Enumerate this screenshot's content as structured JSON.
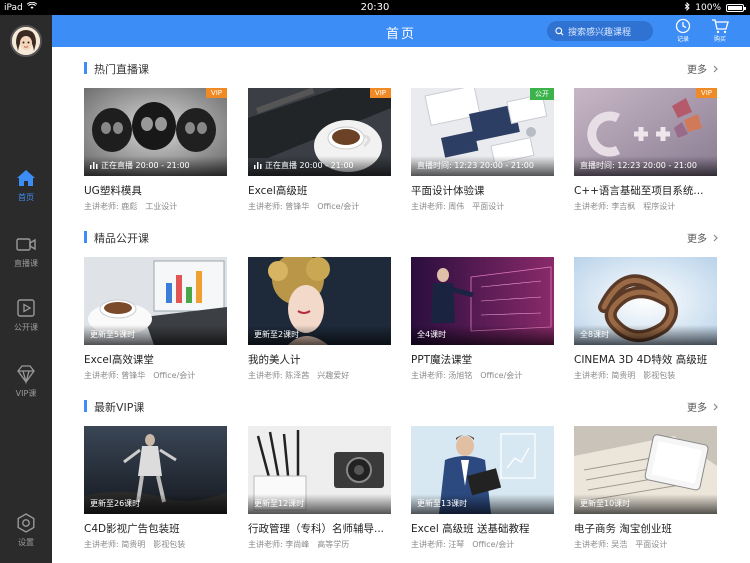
{
  "statusbar": {
    "device": "iPad",
    "time": "20:30",
    "battery": "100%",
    "battery_level": 1.0
  },
  "header": {
    "title": "首页",
    "search_placeholder": "搜索感兴趣课程",
    "record_label": "记录",
    "cart_label": "购买"
  },
  "sidebar": {
    "items": [
      {
        "label": "首页",
        "icon": "home-icon",
        "active": true
      },
      {
        "label": "直播课",
        "icon": "video-camera-icon"
      },
      {
        "label": "公开课",
        "icon": "play-box-icon"
      },
      {
        "label": "VIP课",
        "icon": "diamond-icon"
      },
      {
        "label": "设置",
        "icon": "gear-icon"
      }
    ]
  },
  "more_label": "更多",
  "sections": [
    {
      "title": "热门直播课",
      "cards": [
        {
          "title": "UG塑料模具",
          "teacher": "主讲老师: 鹿彪",
          "category": "工业设计",
          "caption": "正在直播    20:00 - 21:00",
          "badge": "VIP",
          "badge_type": "vip"
        },
        {
          "title": "Excel高级班",
          "teacher": "主讲老师: 曾锋华",
          "category": "Office/会计",
          "caption": "正在直播    20:00 - 21:00",
          "badge": "VIP",
          "badge_type": "vip"
        },
        {
          "title": "平面设计体验课",
          "teacher": "主讲老师: 周伟",
          "category": "平面设计",
          "caption": "直播时间: 12:23  20:00 - 21:00",
          "badge": "公开",
          "badge_type": "open"
        },
        {
          "title": "C++语言基础至项目系统...",
          "teacher": "主讲老师: 李吉枫",
          "category": "程序设计",
          "caption": "直播时间: 12:23  20:00 - 21:00",
          "badge": "VIP",
          "badge_type": "vip"
        }
      ]
    },
    {
      "title": "精品公开课",
      "cards": [
        {
          "title": "Excel高效课堂",
          "teacher": "主讲老师: 曾锋华",
          "category": "Office/会计",
          "caption": "更新至5课时"
        },
        {
          "title": "我的美人计",
          "teacher": "主讲老师: 陈泽茜",
          "category": "兴趣爱好",
          "caption": "更新至2课时"
        },
        {
          "title": "PPT魔法课堂",
          "teacher": "主讲老师: 汤旭铭",
          "category": "Office/会计",
          "caption": "全4课时"
        },
        {
          "title": "CINEMA 3D 4D特效 高级班",
          "teacher": "主讲老师: 简贵明",
          "category": "影视包装",
          "caption": "全8课时"
        }
      ]
    },
    {
      "title": "最新VIP课",
      "cards": [
        {
          "title": "C4D影视广告包装班",
          "teacher": "主讲老师: 简贵明",
          "category": "影视包装",
          "caption": "更新至26课时"
        },
        {
          "title": "行政管理（专科）名师辅导...",
          "teacher": "主讲老师: 李尚峰",
          "category": "高等学历",
          "caption": "更新至12课时"
        },
        {
          "title": "Excel 高级班 送基础教程",
          "teacher": "主讲老师: 汪琴",
          "category": "Office/会计",
          "caption": "更新至13课时"
        },
        {
          "title": "电子商务 淘宝创业班",
          "teacher": "主讲老师: 吴浩",
          "category": "平面设计",
          "caption": "更新至10课时"
        }
      ]
    }
  ]
}
